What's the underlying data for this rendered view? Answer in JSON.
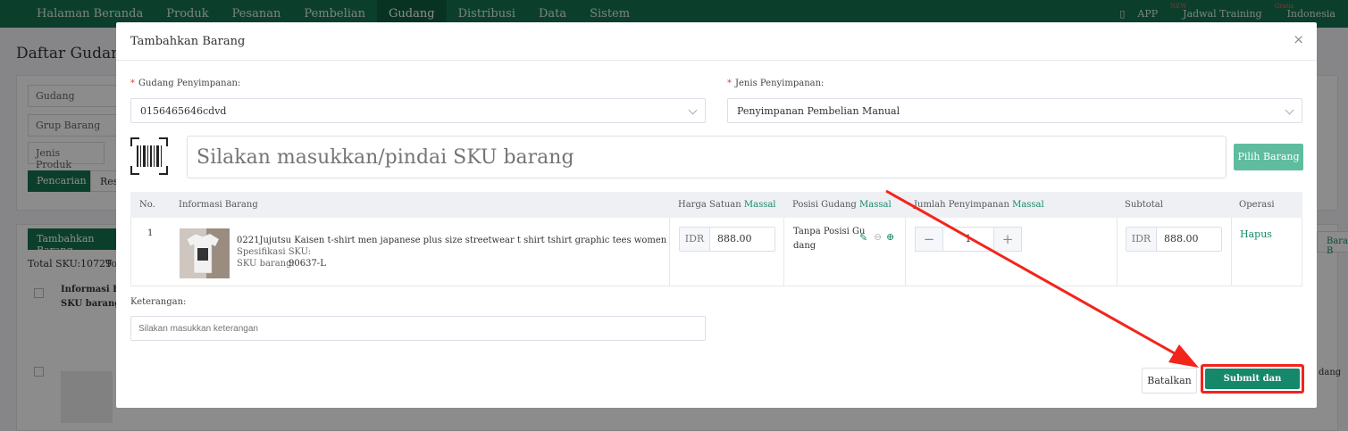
{
  "topnav": {
    "items": [
      "Halaman Beranda",
      "Produk",
      "Pesanan",
      "Pembelian",
      "Gudang",
      "Distribusi",
      "Data",
      "Sistem"
    ],
    "active_index": 4,
    "app_label": "APP",
    "app_badge": "NEW",
    "training_label": "Jadwal Training",
    "training_badge": "Gratis",
    "language": "Indonesia"
  },
  "background": {
    "title": "Daftar Gudang",
    "filter_gudang": "Gudang",
    "filter_grup": "Grup Barang",
    "filter_jenis": "Jenis Produk",
    "search_button": "Pencarian",
    "reset_button": "Rese",
    "add_button": "Tambahkan Barang",
    "total_sku": "Total SKU:10729",
    "total_extra": "To",
    "col_info": "Informasi Bara",
    "col_sku": "SKU barang",
    "right_btn": "Barang B",
    "right_text": "dang"
  },
  "modal": {
    "title": "Tambahkan Barang",
    "gudang_label": "Gudang Penyimpanan:",
    "gudang_value": "0156465646cdvd",
    "jenis_label": "Jenis Penyimpanan:",
    "jenis_value": "Penyimpanan Pembelian Manual",
    "sku_placeholder": "Silakan masukkan/pindai SKU barang",
    "pick_button": "Pilih Barang",
    "table": {
      "col_no": "No.",
      "col_info": "Informasi Barang",
      "col_harga": "Harga Satuan",
      "col_posisi": "Posisi Gudang",
      "col_jumlah": "Jumlah Penyimpanan",
      "col_subtotal": "Subtotal",
      "col_operasi": "Operasi",
      "massal": "Massal",
      "row": {
        "no": "1",
        "name": "0221Jujutsu Kaisen t-shirt men japanese plus size streetwear t shirt tshirt graphic tees women",
        "spec_label": "Spesifikasi SKU:",
        "sku_label": "SKU barang:",
        "sku_value": "90637-L",
        "currency": "IDR",
        "price": "888.00",
        "position_line1": "Tanpa Posisi Gu",
        "position_line2": "dang",
        "quantity": "1",
        "subtotal": "888.00",
        "delete": "Hapus"
      }
    },
    "note_label": "Keterangan:",
    "note_placeholder": "Silakan masukkan keterangan",
    "cancel_button": "Batalkan",
    "submit_button": "Submit dan Simpan"
  },
  "colors": {
    "nav": "#16734f",
    "accent": "#15876a",
    "highlight": "#f3241c"
  }
}
